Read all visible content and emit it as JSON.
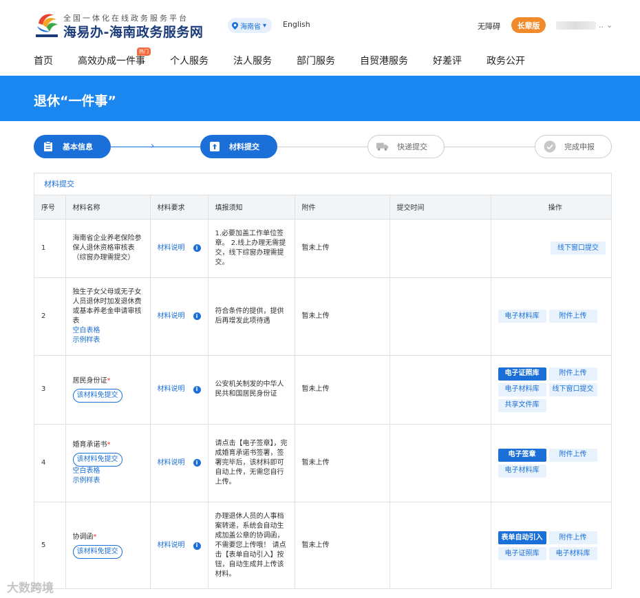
{
  "header": {
    "logo_sub": "全国一体化在线政务服务平台",
    "logo_main": "海易办-海南政务服务网",
    "region": "海南省",
    "english": "English",
    "accessibility": "无障碍",
    "elder_mode": "长辈版",
    "user_suffix": ".."
  },
  "nav": {
    "items": [
      "首页",
      "高效办成一件事",
      "个人服务",
      "法人服务",
      "部门服务",
      "自贸港服务",
      "好差评",
      "政务公开"
    ],
    "hot_badge": "热门"
  },
  "banner": {
    "title": "退休“一件事”"
  },
  "steps": [
    {
      "label": "基本信息",
      "state": "done"
    },
    {
      "label": "材料提交",
      "state": "current"
    },
    {
      "label": "快递提交",
      "state": "pending"
    },
    {
      "label": "完成申报",
      "state": "pending"
    }
  ],
  "panel": {
    "title": "材料提交",
    "columns": [
      "序号",
      "材料名称",
      "材料要求",
      "填报须知",
      "附件",
      "提交时间",
      "操作"
    ],
    "rows": [
      {
        "index": "1",
        "name": "海南省企业养老保险参保人退休资格审核表（综窗办理需提交）",
        "requirement": "材料说明",
        "notice": "1.必要加盖工作单位签章。 2.线上办理无需提交，线下综窗办理需提交。",
        "attachment": "暂未上传",
        "time": "",
        "actions": [
          "线下窗口提交"
        ]
      },
      {
        "index": "2",
        "name": "独生子女父母或无子女人员退休时加发退休费或基本养老金申请审核表",
        "links": [
          "空白表格",
          "示例样表"
        ],
        "requirement": "材料说明",
        "notice": "符合条件的提供，提供后再增发此项待遇",
        "attachment": "暂未上传",
        "time": "",
        "actions": [
          "电子材料库",
          "附件上传"
        ]
      },
      {
        "index": "3",
        "name": "居民身份证",
        "required_mark": "*",
        "exempt": "该材料免提交",
        "requirement": "材料说明",
        "notice": "公安机关制发的中华人民共和国居民身份证",
        "attachment": "暂未上传",
        "time": "",
        "actions": [
          "电子证照库",
          "附件上传",
          "电子材料库",
          "线下窗口提交",
          "共享文件库"
        ]
      },
      {
        "index": "4",
        "name": "婚育承诺书",
        "required_mark": "*",
        "exempt": "该材料免提交",
        "links": [
          "空白表格",
          "示例样表"
        ],
        "requirement": "材料说明",
        "notice": "请点击【电子签章】，完成婚育承诺书签署，签署完毕后，该材料即可自动上传，无需您自行上传。",
        "attachment": "暂未上传",
        "time": "",
        "actions": [
          "电子签章",
          "附件上传",
          "电子材料库"
        ]
      },
      {
        "index": "5",
        "name": "协调函",
        "required_mark": "*",
        "exempt": "该材料免提交",
        "requirement": "材料说明",
        "notice": "办理退休人员的人事档案转递，系统会自动生成加盖公章的协调函，不需要您上传哦！ 请点击【表单自动引入】按钮，自动生成并上传该材料。",
        "attachment": "暂未上传",
        "time": "",
        "actions": [
          "表单自动引入",
          "附件上传",
          "电子证照库",
          "电子材料库"
        ]
      }
    ]
  },
  "watermark": "大数跨境",
  "colors": {
    "primary": "#1a6fd8",
    "banner": "#1a86f0",
    "elder": "#f08a2a"
  }
}
